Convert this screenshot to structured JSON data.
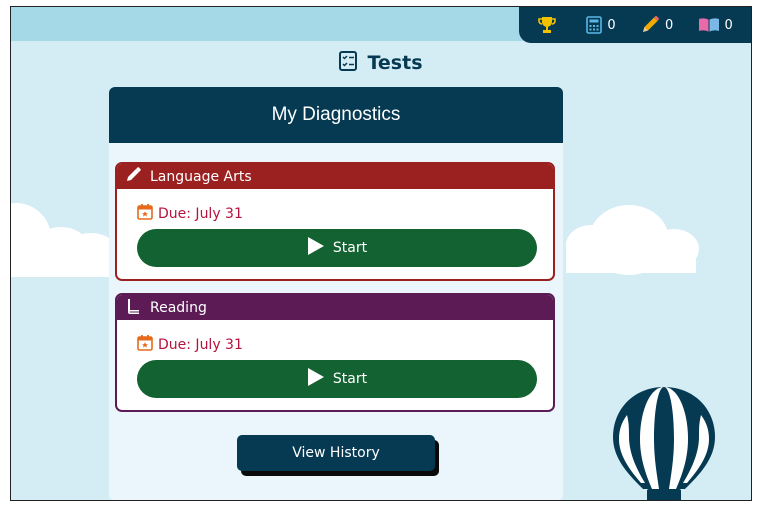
{
  "stats": [
    {
      "icon": "trophy-icon",
      "value": ""
    },
    {
      "icon": "calculator-icon",
      "value": "0"
    },
    {
      "icon": "pencil-icon",
      "value": "0"
    },
    {
      "icon": "book-icon",
      "value": "0"
    }
  ],
  "page": {
    "title": "Tests",
    "icon": "checklist-icon"
  },
  "panel": {
    "title": "My Diagnostics"
  },
  "tests": [
    {
      "subject": "Language Arts",
      "icon": "pencil-icon",
      "due": "Due: July 31",
      "start_label": "Start",
      "color": "#9b2020"
    },
    {
      "subject": "Reading",
      "icon": "book-icon",
      "due": "Due: July 31",
      "start_label": "Start",
      "color": "#5c1b55"
    }
  ],
  "history_label": "View History",
  "colors": {
    "navy": "#063a52",
    "green": "#136232",
    "sky": "#d4ecf4",
    "due": "#b5123e"
  }
}
